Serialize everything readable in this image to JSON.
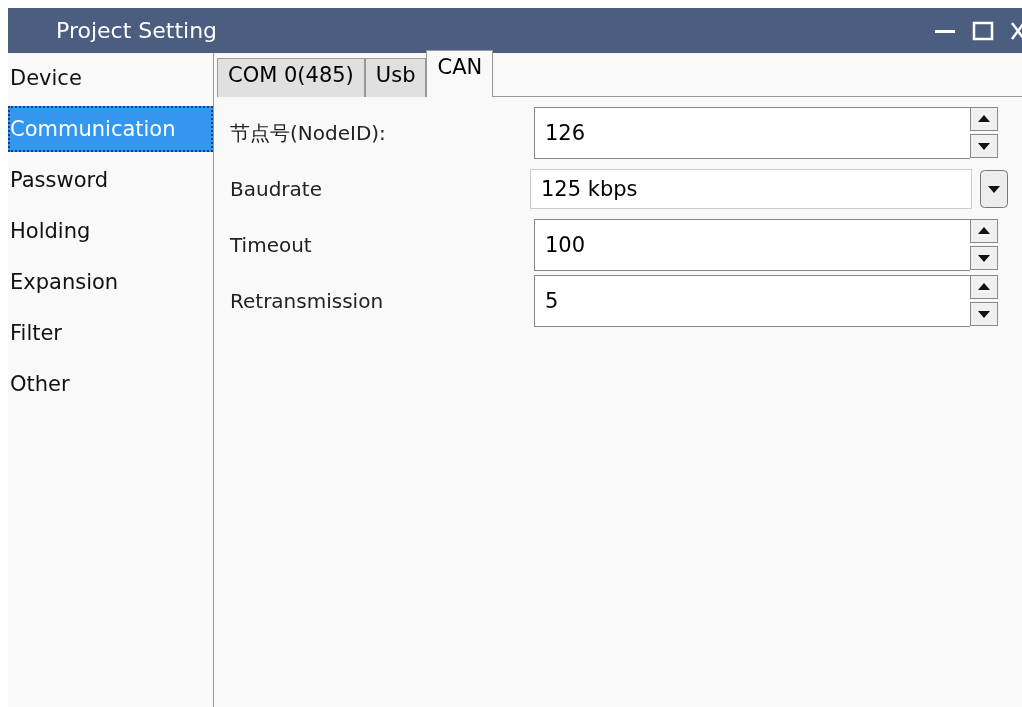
{
  "window": {
    "title": "Project Setting"
  },
  "sidebar": {
    "items": [
      {
        "label": "Device",
        "selected": false
      },
      {
        "label": "Communication",
        "selected": true
      },
      {
        "label": "Password",
        "selected": false
      },
      {
        "label": "Holding",
        "selected": false
      },
      {
        "label": "Expansion",
        "selected": false
      },
      {
        "label": "Filter",
        "selected": false
      },
      {
        "label": "Other",
        "selected": false
      }
    ]
  },
  "tabs": [
    {
      "label": "COM 0(485)",
      "selected": false
    },
    {
      "label": "Usb",
      "selected": false
    },
    {
      "label": "CAN",
      "selected": true
    }
  ],
  "fields": [
    {
      "label": "节点号(NodeID):",
      "kind": "spin",
      "value": "126"
    },
    {
      "label": "Baudrate",
      "kind": "dropdown",
      "value": "125 kbps"
    },
    {
      "label": "Timeout",
      "kind": "spin",
      "value": "100"
    },
    {
      "label": "Retransmission",
      "kind": "spin",
      "value": "5"
    }
  ]
}
